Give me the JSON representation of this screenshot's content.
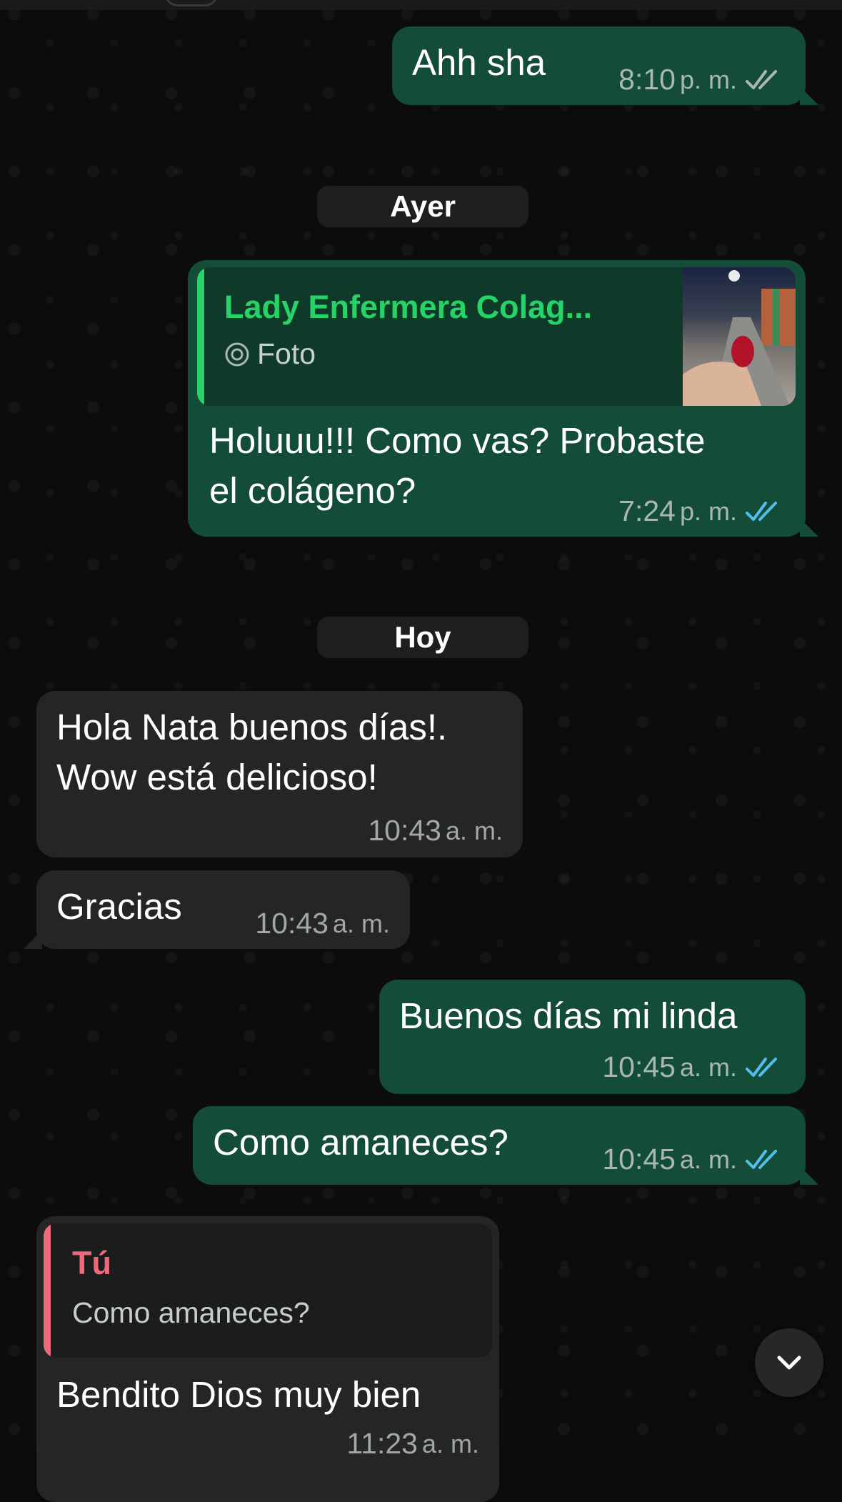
{
  "messages": {
    "m1": {
      "text": "Ahh sha",
      "time": "8:10",
      "ampm": "p. m."
    },
    "m2": {
      "quote_author": "Lady Enfermera Colag...",
      "quote_type": "Foto",
      "text_line1": "Holuuu!!! Como vas? Probaste",
      "text_line2": "el colágeno?",
      "time": "7:24",
      "ampm": "p. m."
    },
    "m3": {
      "text_line1": "Hola Nata buenos días!.",
      "text_line2": "Wow está delicioso!",
      "time": "10:43",
      "ampm": "a. m."
    },
    "m4": {
      "text": "Gracias",
      "time": "10:43",
      "ampm": "a. m."
    },
    "m5": {
      "text": "Buenos días mi linda",
      "time": "10:45",
      "ampm": "a. m."
    },
    "m6": {
      "text": "Como amaneces?",
      "time": "10:45",
      "ampm": "a. m."
    },
    "m7": {
      "quote_author": "Tú",
      "quote_text": "Como amaneces?",
      "text": "Bendito Dios muy bien",
      "time": "11:23",
      "ampm": "a. m."
    }
  },
  "dates": {
    "yesterday": "Ayer",
    "today": "Hoy"
  },
  "colors": {
    "outgoing_bubble": "#144d37",
    "incoming_bubble": "#242626",
    "read_ticks": "#53bdeb",
    "delivered_ticks": "#a9b7b0",
    "quote_author_green": "#25d366",
    "quote_author_red": "#f0697a"
  },
  "icons": {
    "scroll": "chevron-down-icon",
    "photo": "camera-icon",
    "ticks": "double-check-icon"
  }
}
